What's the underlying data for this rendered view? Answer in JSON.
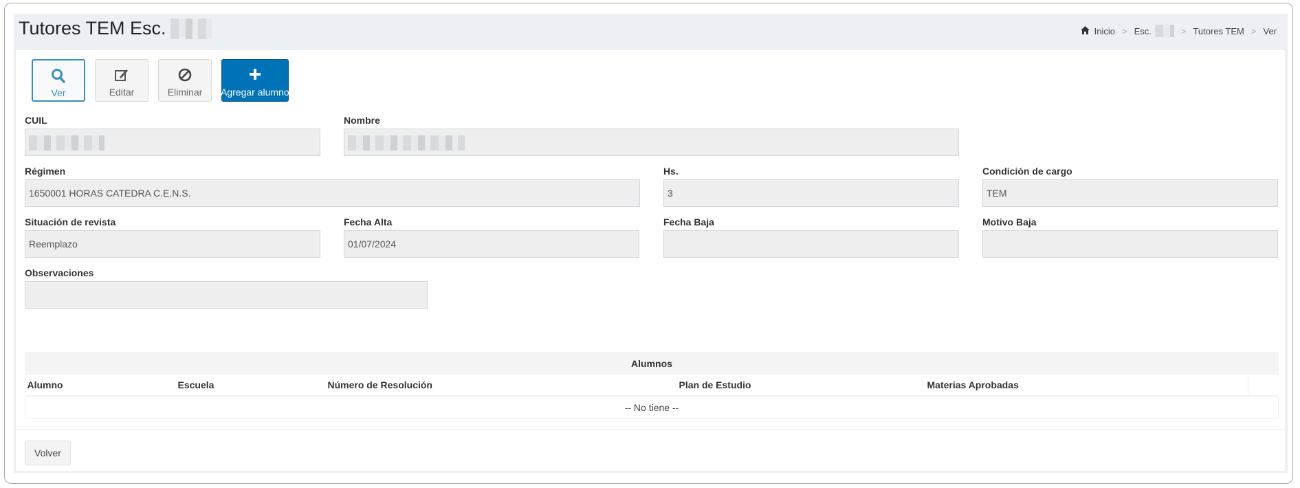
{
  "header": {
    "title": "Tutores TEM Esc.",
    "breadcrumb": {
      "home_icon": "home-icon",
      "items": [
        "Inicio",
        "Esc.",
        "Tutores TEM",
        "Ver"
      ],
      "separator": ">"
    }
  },
  "toolbar": {
    "buttons": [
      {
        "label": "Ver",
        "icon": "search-icon",
        "active": true
      },
      {
        "label": "Editar",
        "icon": "edit-icon"
      },
      {
        "label": "Eliminar",
        "icon": "ban-icon"
      },
      {
        "label": "Agregar alumno",
        "icon": "plus-icon",
        "primary": true
      }
    ]
  },
  "form": {
    "cuil": {
      "label": "CUIL",
      "value": ""
    },
    "nombre": {
      "label": "Nombre",
      "value": ""
    },
    "regimen": {
      "label": "Régimen",
      "value": "1650001 HORAS CATEDRA C.E.N.S."
    },
    "hs": {
      "label": "Hs.",
      "value": "3"
    },
    "condicion": {
      "label": "Condición de cargo",
      "value": "TEM"
    },
    "situacion": {
      "label": "Situación de revista",
      "value": "Reemplazo"
    },
    "fecha_alta": {
      "label": "Fecha Alta",
      "value": "01/07/2024"
    },
    "fecha_baja": {
      "label": "Fecha Baja",
      "value": ""
    },
    "motivo_baja": {
      "label": "Motivo Baja",
      "value": ""
    },
    "observaciones": {
      "label": "Observaciones",
      "value": ""
    }
  },
  "alumnos_table": {
    "caption": "Alumnos",
    "columns": [
      "Alumno",
      "Escuela",
      "Número de Resolución",
      "Plan de Estudio",
      "Materias Aprobadas",
      ""
    ],
    "empty_text": "-- No tiene --"
  },
  "footer": {
    "back_label": "Volver"
  },
  "colors": {
    "primary": "#0073b7",
    "active_border": "#3c8dbc",
    "content_bg": "#ecf0f5",
    "field_bg": "#eeeeee"
  }
}
